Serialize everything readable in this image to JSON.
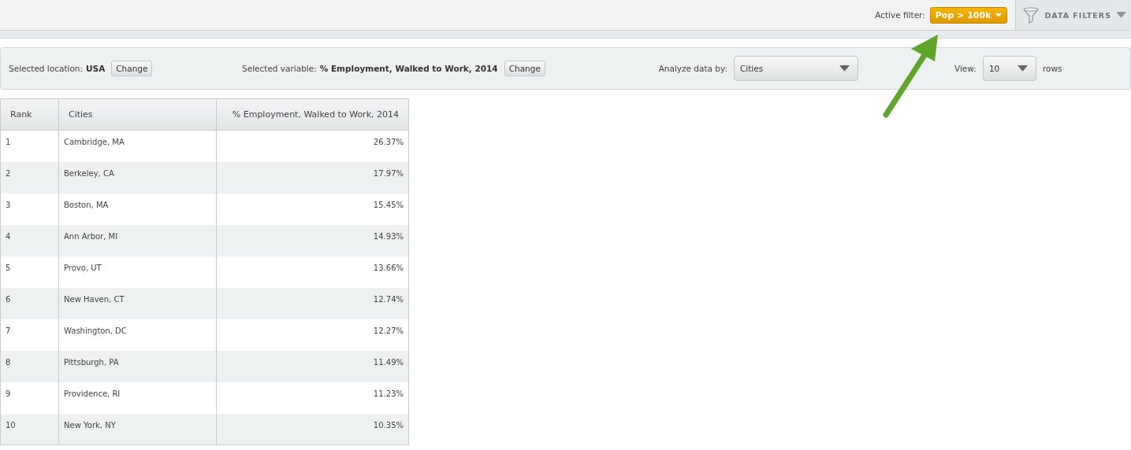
{
  "top_bar": {
    "active_filter_label": "Active filter:",
    "active_filter": "Pop > 100k",
    "data_filters_button": "DATA FILTERS"
  },
  "controls": {
    "location_label": "Selected location:",
    "location": "USA",
    "location_change": "Change",
    "variable_label": "Selected variable:",
    "variable": "% Employment, Walked to Work, 2014",
    "variable_change": "Change",
    "analyze_label": "Analyze data by:",
    "analyze_value": "Cities",
    "view_label": "View:",
    "view_value": "10",
    "view_suffix": "rows"
  },
  "table": {
    "columns": [
      "Rank",
      "Cities",
      "% Employment, Walked to Work, 2014"
    ],
    "rows": [
      {
        "rank": "1",
        "city": "Cambridge, MA",
        "value": "26.37%"
      },
      {
        "rank": "2",
        "city": "Berkeley, CA",
        "value": "17.97%"
      },
      {
        "rank": "3",
        "city": "Boston, MA",
        "value": "15.45%"
      },
      {
        "rank": "4",
        "city": "Ann Arbor, MI",
        "value": "14.93%"
      },
      {
        "rank": "5",
        "city": "Provo, UT",
        "value": "13.66%"
      },
      {
        "rank": "6",
        "city": "New Haven, CT",
        "value": "12.74%"
      },
      {
        "rank": "7",
        "city": "Washington, DC",
        "value": "12.27%"
      },
      {
        "rank": "8",
        "city": "Pittsburgh, PA",
        "value": "11.49%"
      },
      {
        "rank": "9",
        "city": "Providence, RI",
        "value": "11.23%"
      },
      {
        "rank": "10",
        "city": "New York, NY",
        "value": "10.35%"
      }
    ]
  }
}
